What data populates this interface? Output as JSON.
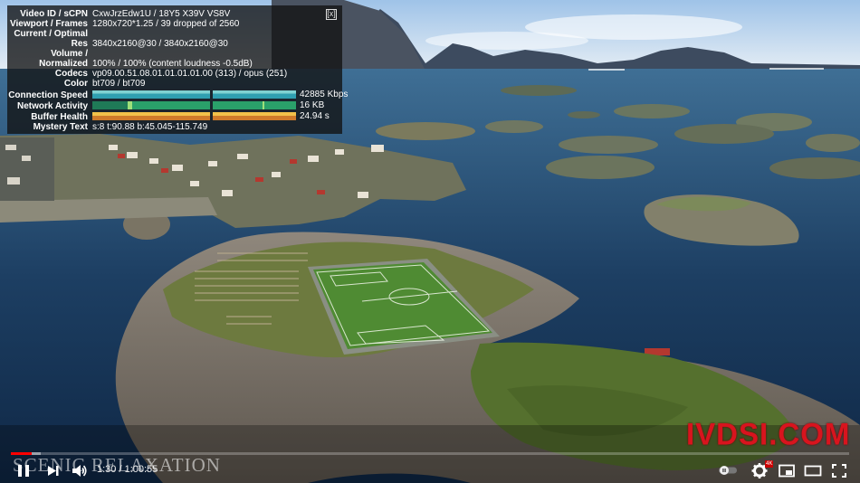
{
  "stats": {
    "close_label": "[x]",
    "rows": [
      {
        "label": "Video ID / sCPN",
        "value": "CxwJrzEdw1U / 18Y5 X39V VS8V"
      },
      {
        "label": "Viewport / Frames",
        "value": "1280x720*1.25 / 39 dropped of 2560"
      },
      {
        "label": "Current / Optimal",
        "value": ""
      },
      {
        "label": "Res",
        "value": "3840x2160@30 / 3840x2160@30"
      },
      {
        "label": "Volume /",
        "value": ""
      },
      {
        "label": "Normalized",
        "value": "100% / 100% (content loudness -0.5dB)"
      },
      {
        "label": "Codecs",
        "value": "vp09.00.51.08.01.01.01.01.00 (313) / opus (251)"
      },
      {
        "label": "Color",
        "value": "bt709 / bt709"
      }
    ],
    "graphs": [
      {
        "label": "Connection Speed",
        "value": "42885 Kbps",
        "colors": [
          "#2f9fb0",
          "#7fd1d1"
        ]
      },
      {
        "label": "Network Activity",
        "value": "16 KB",
        "colors": [
          "#2aa06a",
          "#9ee07a"
        ]
      },
      {
        "label": "Buffer Health",
        "value": "24.94 s",
        "colors": [
          "#cf7a2a",
          "#f2c14a"
        ]
      }
    ],
    "mystery": {
      "label": "Mystery Text",
      "value": "s:8 t:90.88 b:45.045-115.749"
    }
  },
  "overlay": {
    "brand_mark": "SCENIC RELAXATION",
    "watermark": "IVDSI.COM"
  },
  "player": {
    "time_display": "1:30 / 1:00:55",
    "played_fraction": 0.025,
    "loaded_fraction": 0.036,
    "quality_badge": "4K",
    "accent": "#ff0000",
    "icons": [
      "play-pause-icon",
      "next-icon",
      "volume-icon",
      "autoplay-toggle-icon",
      "settings-gear-icon",
      "miniplayer-icon",
      "theater-mode-icon",
      "fullscreen-icon"
    ]
  }
}
